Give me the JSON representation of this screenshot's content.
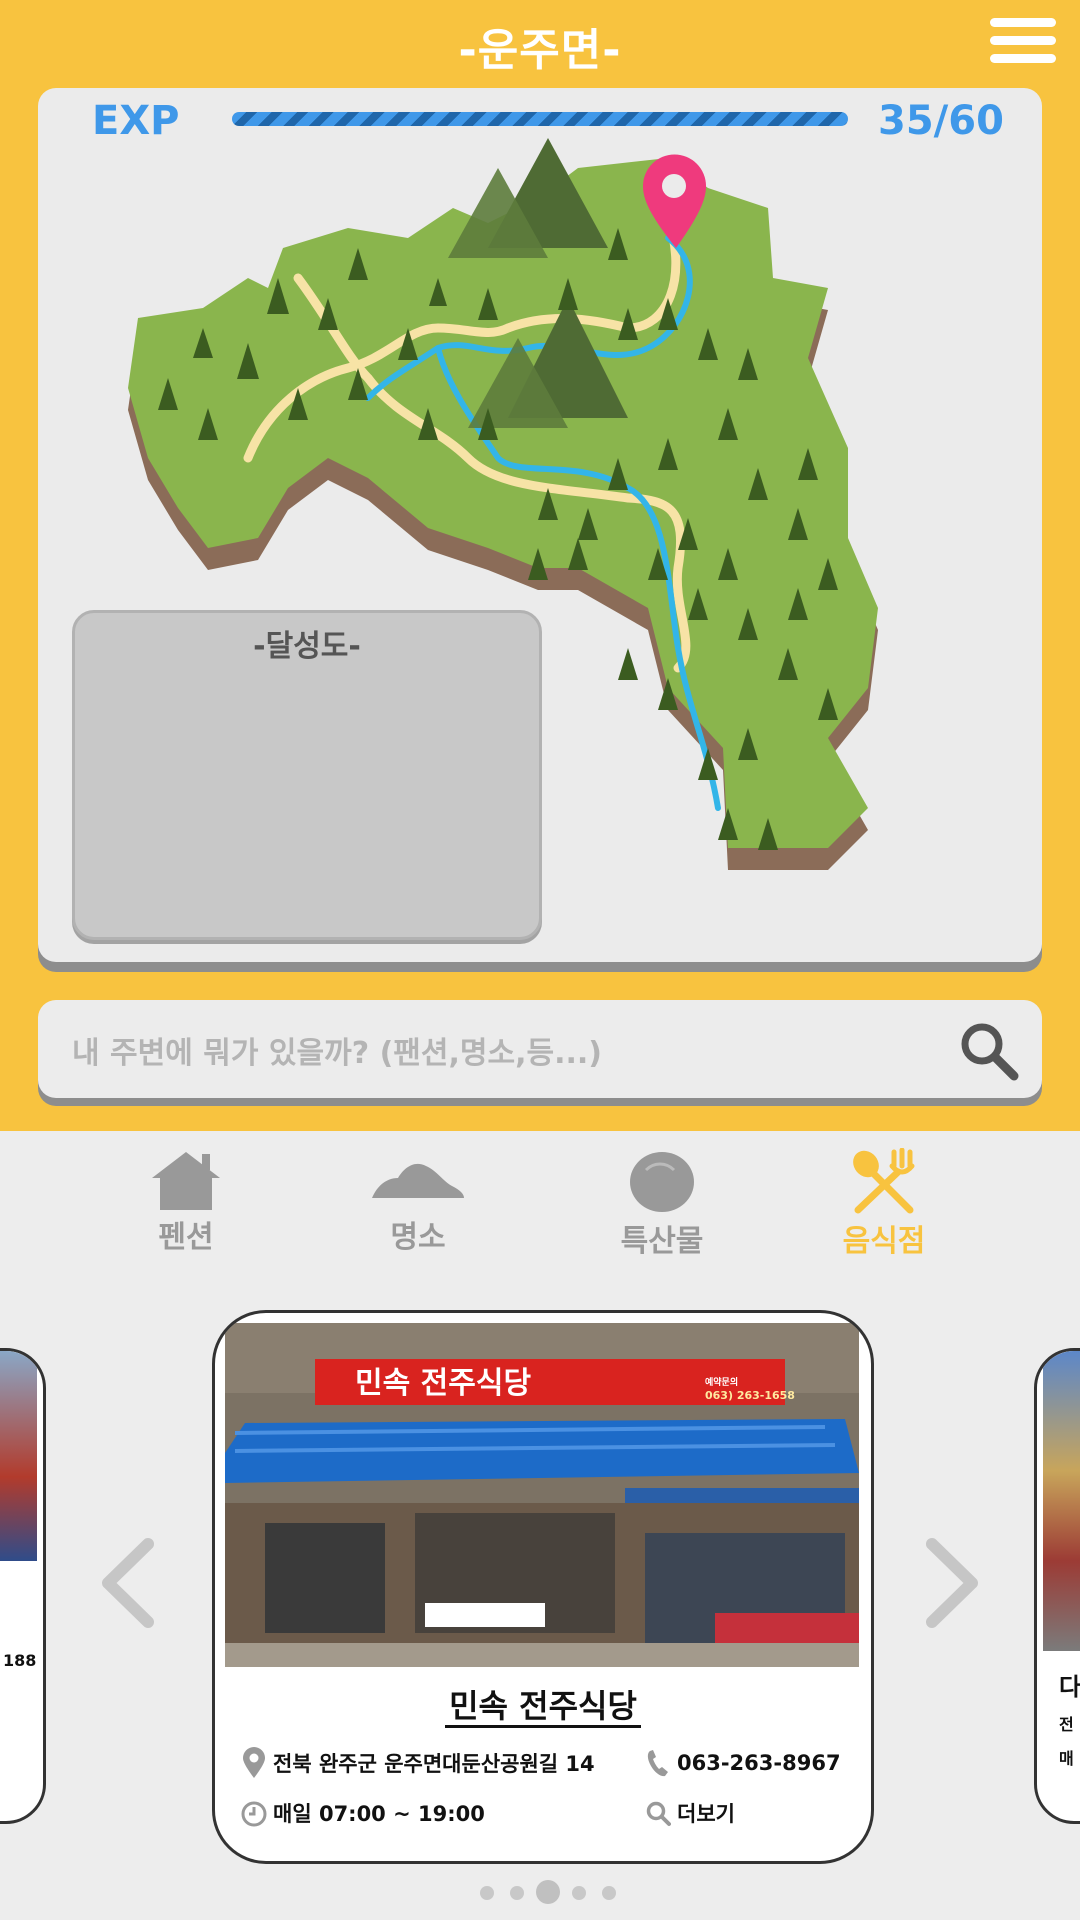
{
  "header": {
    "title": "-운주면-"
  },
  "exp": {
    "label": "EXP",
    "current": 35,
    "max": 60,
    "text": "35/60"
  },
  "achievement": {
    "title": "-달성도-"
  },
  "search": {
    "placeholder": "내 주변에 뭐가 있을까? (팬션,명소,등...)"
  },
  "categories": [
    {
      "label": "펜션",
      "icon": "house-icon",
      "active": false
    },
    {
      "label": "명소",
      "icon": "mountain-icon",
      "active": false
    },
    {
      "label": "특산물",
      "icon": "stone-icon",
      "active": false
    },
    {
      "label": "음식점",
      "icon": "fork-spoon-icon",
      "active": true
    }
  ],
  "restaurant": {
    "name": "민속 전주식당",
    "address": "전북 완주군 운주면대둔산공원길 14",
    "phone": "063-263-8967",
    "hours": "매일 07:00 ~ 19:00",
    "more": "더보기",
    "photo_sign": "민속 전주식당",
    "photo_sign_phone": "063) 263-1658",
    "photo_sign_small": "예약문의"
  },
  "side_cards": {
    "left_fragment": "188",
    "right_fragment_title": "다",
    "right_fragment_line1": "전",
    "right_fragment_line2": "매"
  },
  "pager": {
    "count": 5,
    "active_index": 2
  },
  "colors": {
    "accent": "#f8c33f",
    "exp_blue": "#3f98e9",
    "pin": "#ef3a7d",
    "map_green": "#8ab54d"
  }
}
